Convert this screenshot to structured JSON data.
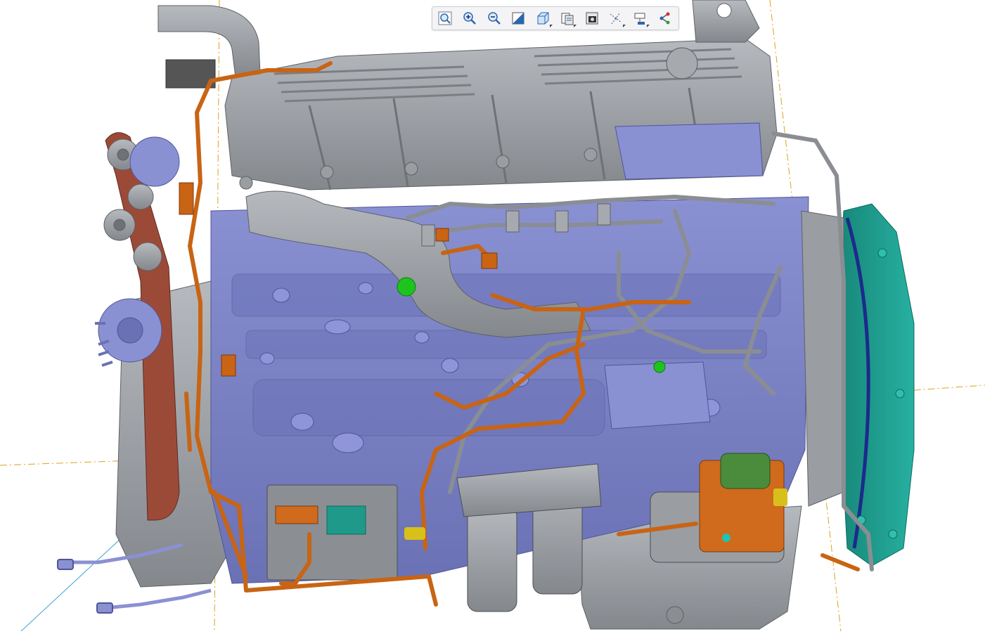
{
  "viewer": {
    "background": "#ffffff",
    "model_name_visible": false
  },
  "toolbar": {
    "items": [
      {
        "name": "refit-icon"
      },
      {
        "name": "zoom-in-icon"
      },
      {
        "name": "zoom-out-icon"
      },
      {
        "name": "repaint-icon"
      },
      {
        "name": "saved-views-icon"
      },
      {
        "name": "view-manager-icon"
      },
      {
        "name": "display-style-icon"
      },
      {
        "name": "datum-display-icon"
      },
      {
        "name": "annotation-display-icon"
      },
      {
        "name": "spin-center-icon"
      }
    ]
  },
  "colors": {
    "block": "#7f86c8",
    "block_dark": "#5e65a6",
    "metal": "#9a9ea3",
    "metal_dark": "#6e7276",
    "harness": "#c86414",
    "belt": "#9c4a38",
    "flywheel_housing": "#1f9a8a",
    "starter_body": "#d06a1c",
    "starter_solenoid": "#4a8c3c",
    "datum_line": "#e0a020",
    "axis_line": "#40a0d0"
  }
}
